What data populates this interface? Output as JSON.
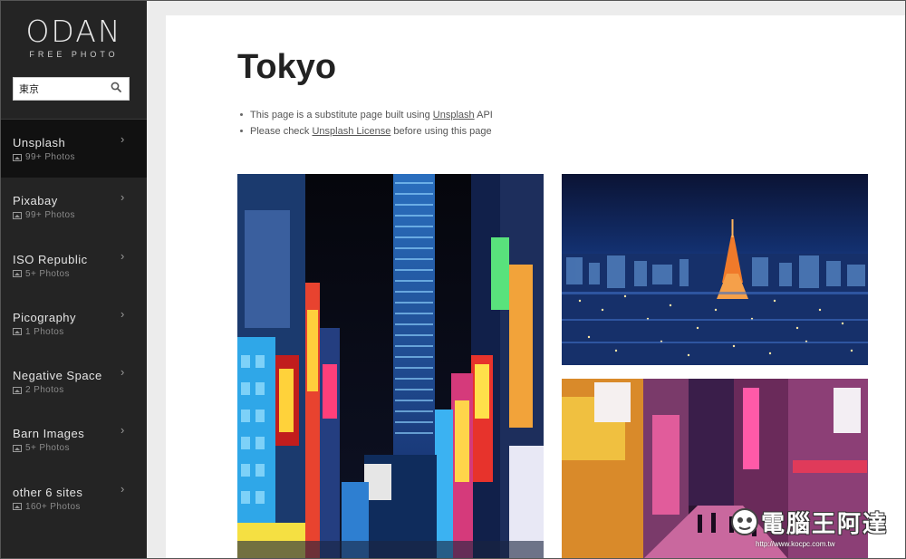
{
  "brand": {
    "logo": "ODAN",
    "tagline": "FREE PHOTO"
  },
  "search": {
    "value": "東京",
    "placeholder": ""
  },
  "sites": [
    {
      "name": "Unsplash",
      "count": "99+ Photos",
      "active": true
    },
    {
      "name": "Pixabay",
      "count": "99+ Photos",
      "active": false
    },
    {
      "name": "ISO Republic",
      "count": "5+ Photos",
      "active": false
    },
    {
      "name": "Picography",
      "count": "1 Photos",
      "active": false
    },
    {
      "name": "Negative Space",
      "count": "2 Photos",
      "active": false
    },
    {
      "name": "Barn Images",
      "count": "5+ Photos",
      "active": false
    },
    {
      "name": "other 6 sites",
      "count": "160+ Photos",
      "active": false
    }
  ],
  "main": {
    "title": "Tokyo",
    "note1": {
      "prefix": "This page is a substitute page built using ",
      "link": "Unsplash",
      "suffix": " API"
    },
    "note2": {
      "prefix": "Please check ",
      "link": "Unsplash License",
      "suffix": " before using this page"
    }
  },
  "photos": [
    {
      "name": "shinjuku-neon-street-photo"
    },
    {
      "name": "tokyo-tower-night-skyline-photo"
    },
    {
      "name": "neon-alley-night-photo"
    }
  ],
  "watermark": {
    "text": "電腦王阿達",
    "url": "http://www.kocpc.com.tw"
  },
  "colors": {
    "sidebar": "#242424",
    "active_item": "#111111",
    "main_bg": "#ffffff",
    "page_bg": "#ececec"
  },
  "icons": {
    "search": "search-icon",
    "chevron": "chevron-right-icon",
    "photos": "image-icon"
  }
}
